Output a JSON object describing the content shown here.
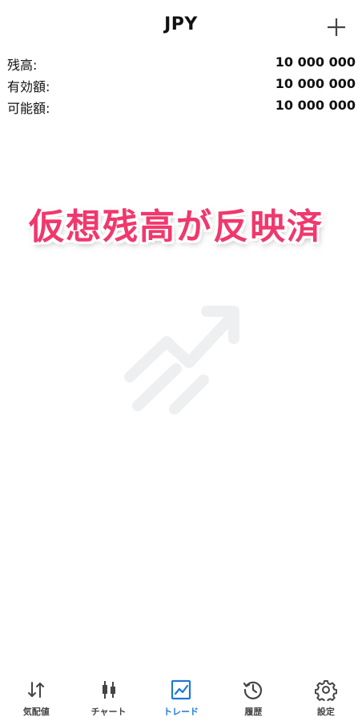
{
  "header": {
    "title": "JPY",
    "add_icon": "plus-icon"
  },
  "account": [
    {
      "label": "残高:",
      "value": "10 000 000"
    },
    {
      "label": "有効額:",
      "value": "10 000 000"
    },
    {
      "label": "可能額:",
      "value": "10 000 000"
    }
  ],
  "overlay": {
    "text": "仮想残高が反映済",
    "color": "#f0386d"
  },
  "empty_state": {
    "icon": "trend-arrow-icon",
    "color": "#eeeff1"
  },
  "tabs": [
    {
      "label": "気配値",
      "icon": "quotes-arrows-icon",
      "active": false
    },
    {
      "label": "チャート",
      "icon": "candlestick-icon",
      "active": false
    },
    {
      "label": "トレード",
      "icon": "trade-chart-icon",
      "active": true
    },
    {
      "label": "履歴",
      "icon": "history-icon",
      "active": false
    },
    {
      "label": "設定",
      "icon": "gear-icon",
      "active": false
    }
  ],
  "colors": {
    "accent": "#1e78d8",
    "inactive": "#444444"
  }
}
